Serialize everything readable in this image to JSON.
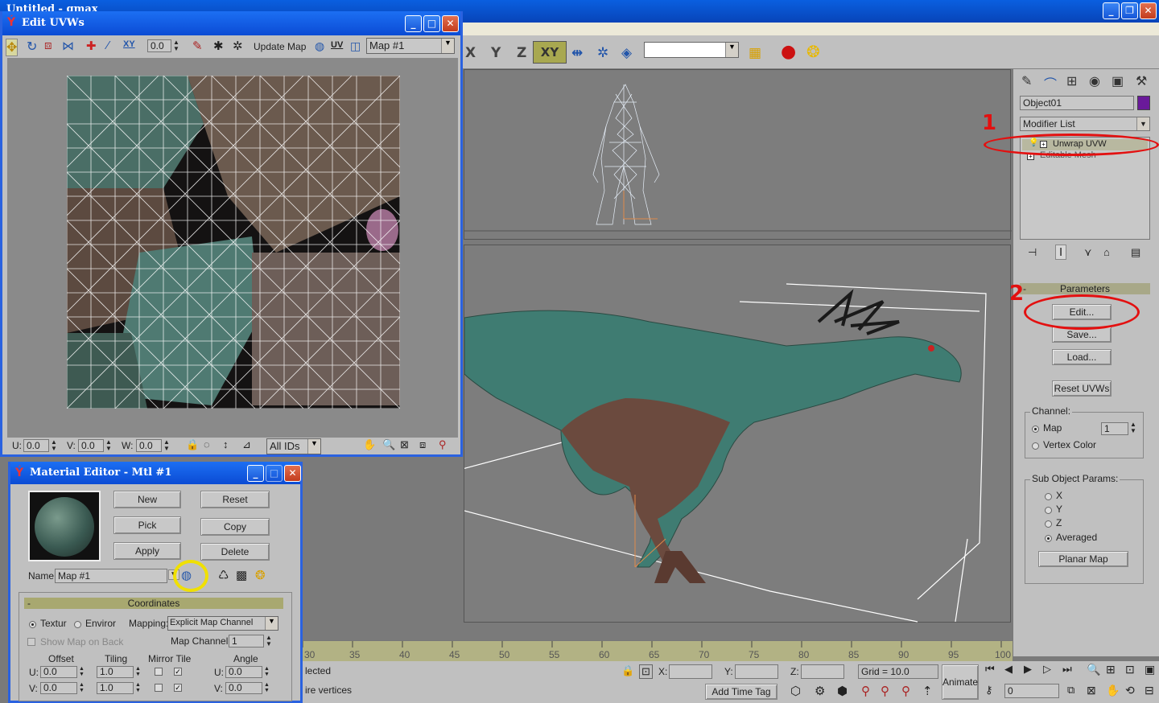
{
  "app": {
    "title": "Untitled - gmax"
  },
  "main_toolbar": {
    "axis_x": "X",
    "axis_y": "Y",
    "axis_z": "Z",
    "axis_xy": "XY",
    "named_selection_value": ""
  },
  "command_panel": {
    "object_name": "Object01",
    "modifier_list_label": "Modifier List",
    "stack": [
      {
        "label": "Unwrap UVW"
      },
      {
        "label": "Editable Mesh"
      }
    ],
    "parameters_header": "Parameters",
    "buttons": {
      "edit": "Edit...",
      "save": "Save...",
      "load": "Load...",
      "reset_uvws": "Reset UVWs",
      "planar_map": "Planar Map"
    },
    "channel": {
      "title": "Channel:",
      "map_label": "Map",
      "map_value": "1",
      "vertex_color_label": "Vertex Color",
      "selected": "Map"
    },
    "sub_object": {
      "title": "Sub Object Params:",
      "options": [
        "X",
        "Y",
        "Z",
        "Averaged"
      ],
      "selected": "Averaged"
    },
    "annotations": {
      "one": "1",
      "two": "2"
    },
    "object_color": "#6a1a9a"
  },
  "timeline": {
    "ticks": [
      "30",
      "35",
      "40",
      "45",
      "50",
      "55",
      "60",
      "65",
      "70",
      "75",
      "80",
      "85",
      "90",
      "95",
      "100"
    ]
  },
  "status_bar": {
    "selection_text": "lected",
    "prompt_text": "ire vertices",
    "x_label": "X:",
    "y_label": "Y:",
    "z_label": "Z:",
    "grid": "Grid = 10.0",
    "add_time_tag": "Add Time Tag",
    "animate": "Animate",
    "frame": "0"
  },
  "uvw_window": {
    "title": "Edit UVWs",
    "update_map": "Update Map",
    "uv_label": "UV",
    "xy_label": "XY",
    "spinner_value": "0.0",
    "map_dropdown": "Map #1",
    "u_label": "U:",
    "u_value": "0.0",
    "v_label": "V:",
    "v_value": "0.0",
    "w_label": "W:",
    "w_value": "0.0",
    "ids_dropdown": "All IDs"
  },
  "material_editor": {
    "title": "Material Editor - Mtl #1",
    "buttons": {
      "new": "New",
      "reset": "Reset",
      "pick": "Pick",
      "copy": "Copy",
      "apply": "Apply",
      "delete": "Delete"
    },
    "name_label": "Name",
    "name_value": "Map #1",
    "coordinates_header": "Coordinates",
    "texture_label": "Textur",
    "environ_label": "Enviror",
    "mapping_label": "Mapping:",
    "mapping_value": "Explicit Map Channel",
    "show_map_on_back": "Show Map on Back",
    "map_channel_label": "Map Channel:",
    "map_channel_value": "1",
    "offset_label": "Offset",
    "tiling_label": "Tiling",
    "mirror_tile_label": "Mirror Tile",
    "angle_label": "Angle",
    "u_label": "U:",
    "v_label": "V:",
    "offset_u": "0.0",
    "offset_v": "0.0",
    "tiling_u": "1.0",
    "tiling_v": "1.0",
    "angle_u": "0.0",
    "angle_v": "0.0"
  }
}
